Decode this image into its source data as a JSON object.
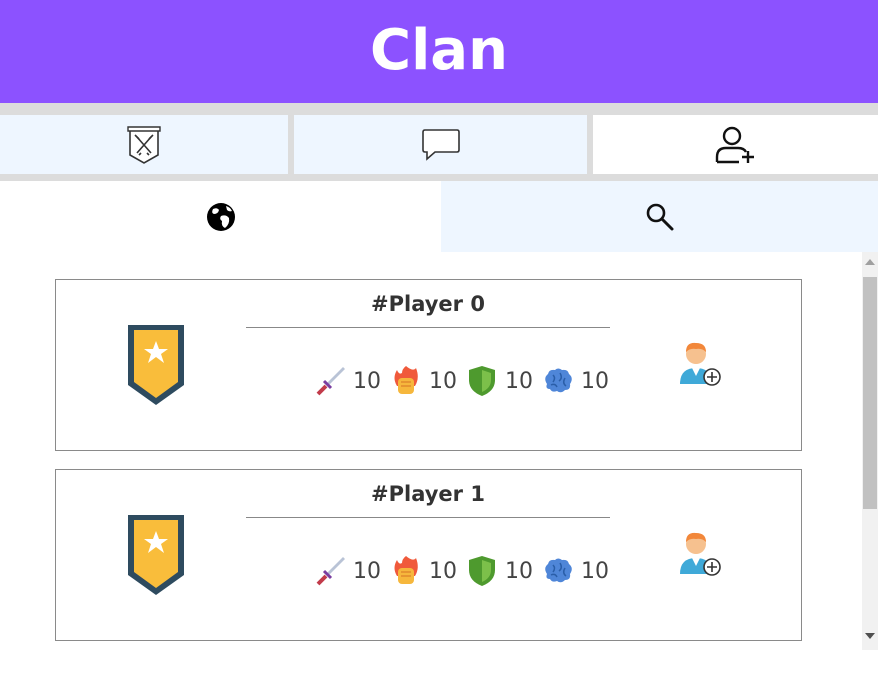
{
  "header": {
    "title": "Clan"
  },
  "tabs": [
    {
      "icon": "clan-banner-icon"
    },
    {
      "icon": "chat-bubble-icon"
    },
    {
      "icon": "add-user-icon"
    }
  ],
  "subtabs": [
    {
      "icon": "globe-icon"
    },
    {
      "icon": "search-icon"
    }
  ],
  "players": [
    {
      "name": "#Player 0",
      "attack": "10",
      "power": "10",
      "defense": "10",
      "intellect": "10"
    },
    {
      "name": "#Player 1",
      "attack": "10",
      "power": "10",
      "defense": "10",
      "intellect": "10"
    }
  ],
  "colors": {
    "header": "#8c52ff",
    "tab_active": "#eef6ff"
  }
}
